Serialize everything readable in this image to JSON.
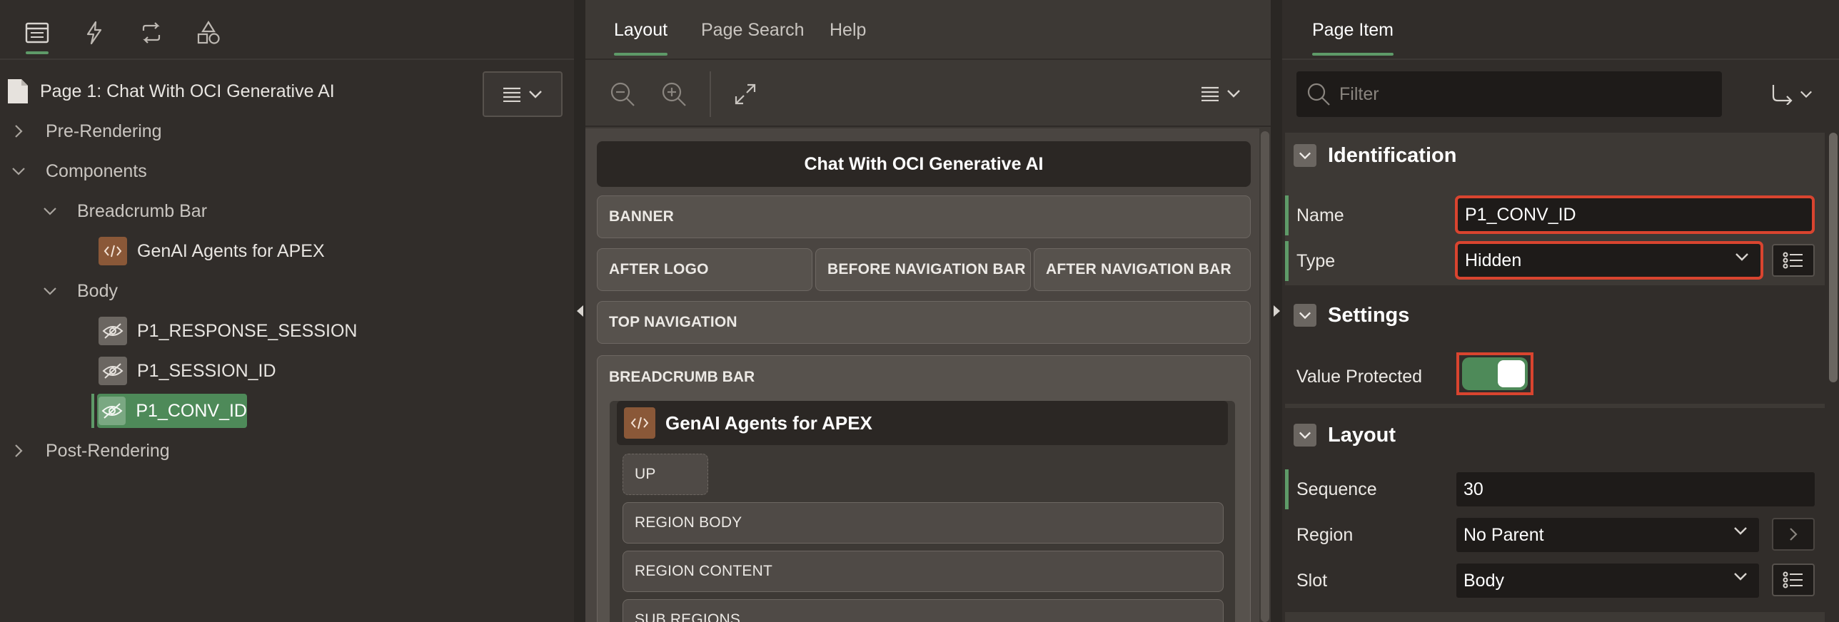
{
  "left_panel": {
    "tabs": [
      {
        "name": "rendering-tab",
        "icon": "rendering-icon"
      },
      {
        "name": "dynamic-actions-tab",
        "icon": "lightning-icon"
      },
      {
        "name": "processing-tab",
        "icon": "processing-icon"
      },
      {
        "name": "shared-components-tab",
        "icon": "shapes-icon"
      }
    ],
    "page_title": "Page 1: Chat With OCI Generative AI",
    "tree": {
      "pre_rendering": "Pre-Rendering",
      "components": "Components",
      "breadcrumb_bar": "Breadcrumb Bar",
      "genai_agents": "GenAI Agents for APEX",
      "body": "Body",
      "item_response_session": "P1_RESPONSE_SESSION",
      "item_session_id": "P1_SESSION_ID",
      "item_conv_id": "P1_CONV_ID",
      "post_rendering": "Post-Rendering"
    }
  },
  "middle_panel": {
    "tabs": [
      "Layout",
      "Page Search",
      "Help"
    ],
    "page_title": "Chat With OCI Generative AI",
    "slots": {
      "banner": "BANNER",
      "after_logo": "AFTER LOGO",
      "before_nav": "BEFORE NAVIGATION BAR",
      "after_nav": "AFTER NAVIGATION BAR",
      "top_nav": "TOP NAVIGATION",
      "breadcrumb_bar": "BREADCRUMB BAR",
      "genai_region": "GenAI Agents for APEX",
      "up": "UP",
      "region_body": "REGION BODY",
      "region_content": "REGION CONTENT",
      "sub_regions": "SUB REGIONS"
    }
  },
  "right_panel": {
    "tab": "Page Item",
    "filter_placeholder": "Filter",
    "identification": {
      "title": "Identification",
      "name_label": "Name",
      "name_value": "P1_CONV_ID",
      "type_label": "Type",
      "type_value": "Hidden"
    },
    "settings": {
      "title": "Settings",
      "value_protected_label": "Value Protected",
      "value_protected": true
    },
    "layout": {
      "title": "Layout",
      "sequence_label": "Sequence",
      "sequence_value": "30",
      "region_label": "Region",
      "region_value": "No Parent",
      "slot_label": "Slot",
      "slot_value": "Body"
    }
  },
  "colors": {
    "accent_green": "#5e9a68",
    "highlight_red": "#d9442f",
    "code_icon_bg": "#8a5838"
  }
}
